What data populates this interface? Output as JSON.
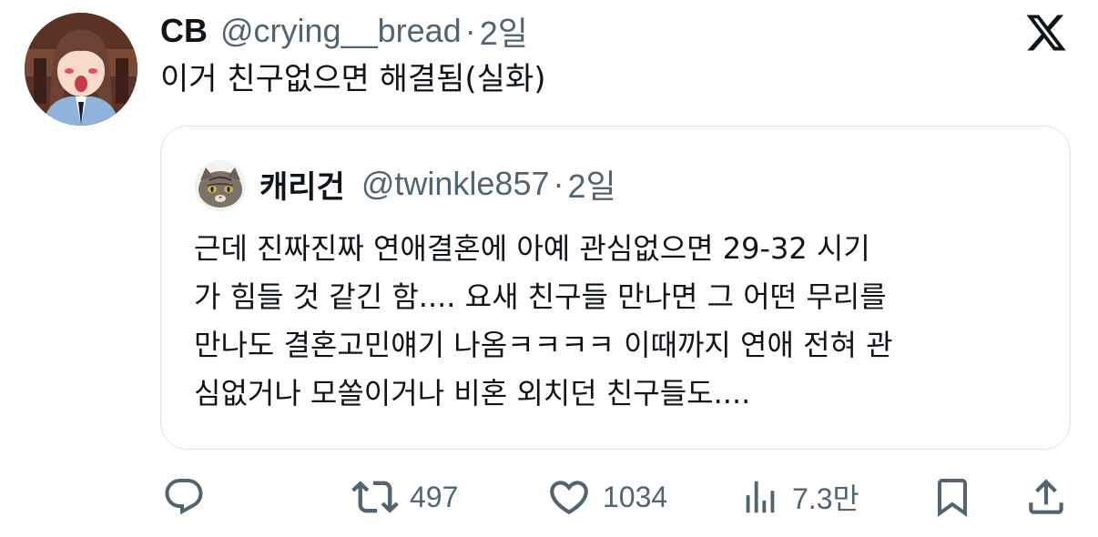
{
  "post": {
    "author_name": "CB",
    "author_handle": "@crying__bread",
    "separator": "·",
    "time": "2일",
    "text": "이거 친구없으면 해결됨(실화)"
  },
  "quoted": {
    "author_name": "캐리건",
    "author_handle": "@twinkle857",
    "separator": "·",
    "time": "2일",
    "lines": [
      "근데 진짜진짜 연애결혼에 아예 관심없으면 29-32 시기",
      "가 힘들 것 같긴 함.... 요새 친구들 만나면 그 어떤 무리를",
      "만나도 결혼고민얘기 나옴ㅋㅋㅋㅋ 이때까지 연애 전혀 관",
      "심없거나 모쏠이거나 비혼 외치던 친구들도...."
    ]
  },
  "actions": {
    "reply": {
      "icon": "reply-icon"
    },
    "repost": {
      "icon": "repost-icon",
      "count": "497"
    },
    "like": {
      "icon": "heart-icon",
      "count": "1034"
    },
    "views": {
      "icon": "views-icon",
      "count": "7.3만"
    },
    "bookmark": {
      "icon": "bookmark-icon"
    },
    "share": {
      "icon": "share-icon"
    }
  },
  "branding": {
    "logo": "x-logo-icon"
  },
  "colors": {
    "text_primary": "#0f1419",
    "text_secondary": "#536471",
    "card_border": "#dfe3e7",
    "background": "#ffffff"
  }
}
